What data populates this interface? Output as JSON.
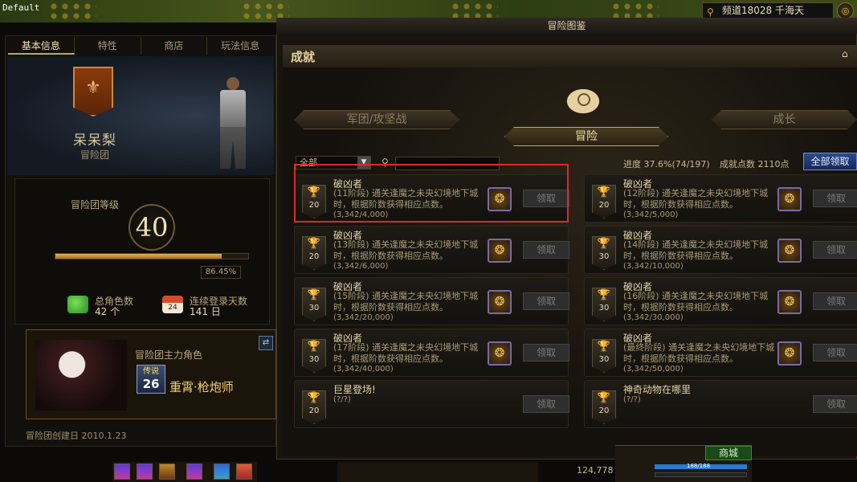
{
  "top": {
    "default_label": "Default",
    "channel": "频道18028 千海天"
  },
  "left_panel": {
    "tabs": [
      "基本信息",
      "特性",
      "商店",
      "玩法信息"
    ],
    "team_name": "呆呆梨",
    "team_sub": "冒险团",
    "level_title": "冒险团等级",
    "level": "40",
    "exp_percent": "86.45%",
    "exp_fraction": 0.8645,
    "total_chars_label": "总角色数",
    "total_chars_value": "42 个",
    "login_days_label": "连续登录天数",
    "login_days_value": "141 日",
    "calendar_num": "24",
    "main_char_label": "冒险团主力角色",
    "main_char_tier": "传说",
    "main_char_level": "26",
    "main_char_name": "重霄·枪炮师",
    "created": "冒险团创建日 2010.1.23"
  },
  "achievement": {
    "window_title": "冒险图鉴",
    "section_title": "成就",
    "back": "返",
    "tabs": {
      "left": "军团/攻坚战",
      "center": "冒险",
      "right": "成长"
    },
    "filter": "全部",
    "progress": "进度 37.6%(74/197)",
    "points": "成就点数 2110点",
    "receive_all": "全部领取",
    "claim_label": "领取",
    "cards": [
      {
        "title": "破凶者",
        "desc": "(11阶段) 通关逢魔之未央幻境地下城时，根据阶数获得相应点数。",
        "progress": "(3,342/4,000)",
        "points": "20"
      },
      {
        "title": "破凶者",
        "desc": "(12阶段) 通关逢魔之未央幻境地下城时，根据阶数获得相应点数。",
        "progress": "(3,342/5,000)",
        "points": "20"
      },
      {
        "title": "破凶者",
        "desc": "(13阶段) 通关逢魔之未央幻境地下城时，根据阶数获得相应点数。",
        "progress": "(3,342/6,000)",
        "points": "20"
      },
      {
        "title": "破凶者",
        "desc": "(14阶段) 通关逢魔之未央幻境地下城时，根据阶数获得相应点数。",
        "progress": "(3,342/10,000)",
        "points": "30"
      },
      {
        "title": "破凶者",
        "desc": "(15阶段) 通关逢魔之未央幻境地下城时，根据阶数获得相应点数。",
        "progress": "(3,342/20,000)",
        "points": "30"
      },
      {
        "title": "破凶者",
        "desc": "(16阶段) 通关逢魔之未央幻境地下城时，根据阶数获得相应点数。",
        "progress": "(3,342/30,000)",
        "points": "30"
      },
      {
        "title": "破凶者",
        "desc": "(17阶段) 通关逢魔之未央幻境地下城时，根据阶数获得相应点数。",
        "progress": "(3,342/40,000)",
        "points": "30"
      },
      {
        "title": "破凶者",
        "desc": "(最终阶段) 通关逢魔之未央幻境地下城时，根据阶数获得相应点数。",
        "progress": "(3,342/50,000)",
        "points": "30"
      },
      {
        "title": "巨星登场!",
        "desc": "",
        "progress": "(?/?)",
        "points": "20"
      },
      {
        "title": "神奇动物在哪里",
        "desc": "",
        "progress": "(?/?)",
        "points": "20"
      }
    ]
  },
  "hud": {
    "gold": "124,778",
    "shop": "商城",
    "hp_text": "188/188"
  },
  "colors": {
    "accent_gold": "#c9a64a",
    "highlight_red": "#e0282a",
    "receive_all_blue": "#2e4a8a"
  },
  "icons": [
    "home-icon",
    "search-icon",
    "trophy-icon",
    "reward-icon",
    "swap-icon",
    "people-icon",
    "calendar-icon"
  ]
}
